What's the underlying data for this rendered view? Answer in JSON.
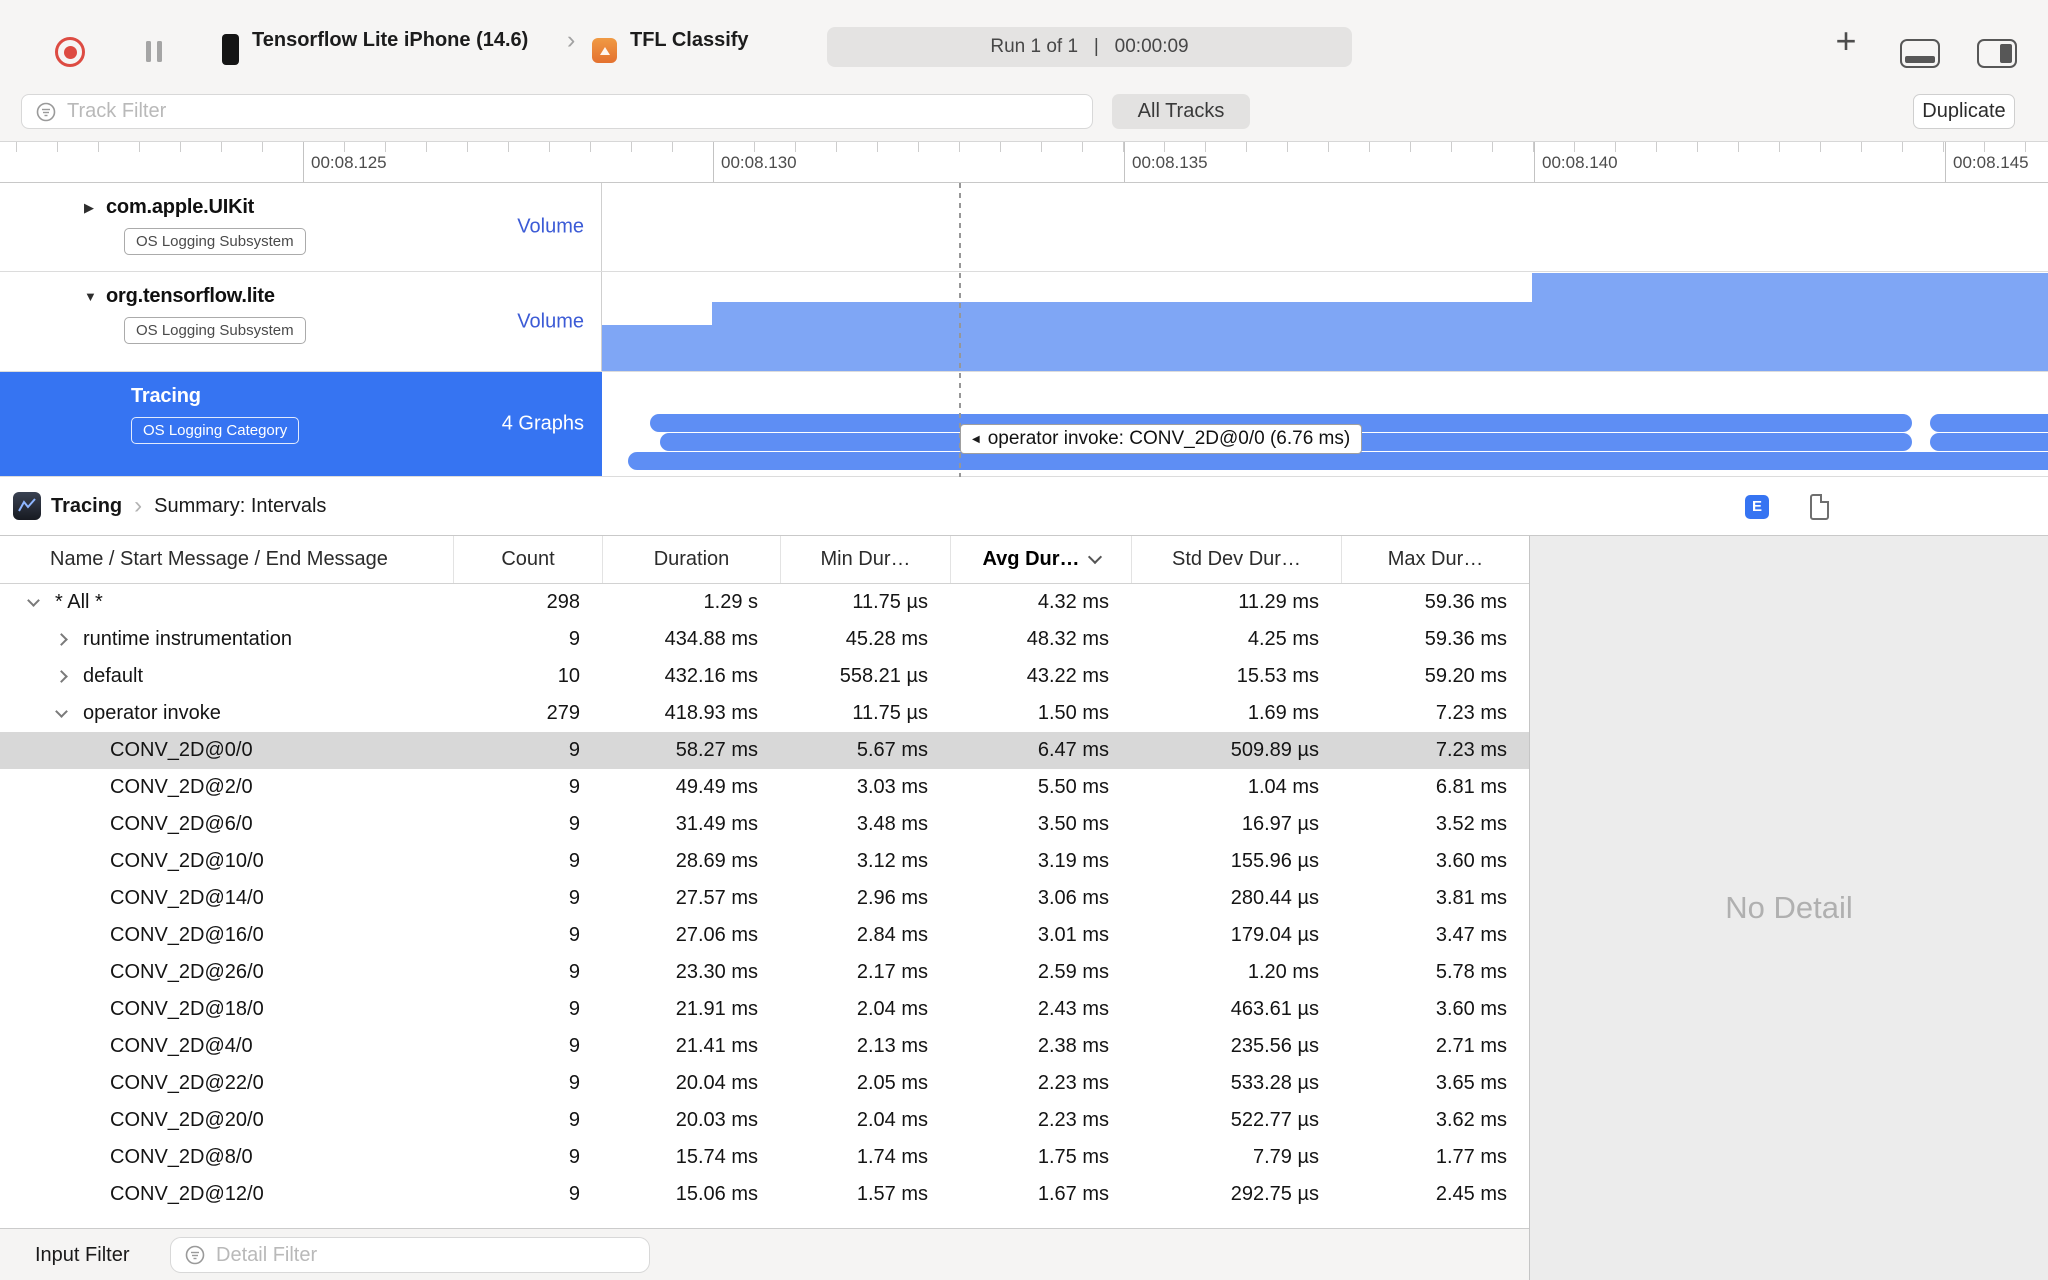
{
  "toolbar": {
    "device": "Tensorflow Lite iPhone (14.6)",
    "target": "TFL Classify",
    "status": "Run 1 of 1   |   00:00:09"
  },
  "filter_bar": {
    "track_filter_placeholder": "Track Filter",
    "all_tracks_label": "All Tracks",
    "duplicate_label": "Duplicate"
  },
  "ruler": {
    "labels": [
      "00:08.125",
      "00:08.130",
      "00:08.135",
      "00:08.140",
      "00:08.145"
    ]
  },
  "tracks": [
    {
      "name": "com.apple.UIKit",
      "badge": "OS Logging Subsystem",
      "meta": "Volume",
      "disclosure": "collapsed",
      "selected": false
    },
    {
      "name": "org.tensorflow.lite",
      "badge": "OS Logging Subsystem",
      "meta": "Volume",
      "disclosure": "expanded",
      "selected": false
    },
    {
      "name": "Tracing",
      "badge": "OS Logging Category",
      "meta": "4 Graphs",
      "disclosure": "none",
      "selected": true
    }
  ],
  "tooltip": "operator invoke: CONV_2D@0/0 (6.76 ms)",
  "breadcrumb": {
    "instrument": "Tracing",
    "summary": "Summary: Intervals",
    "e_badge": "E"
  },
  "table": {
    "columns": [
      "Name / Start Message / End Message",
      "Count",
      "Duration",
      "Min Dur…",
      "Avg Dur…",
      "Std Dev Dur…",
      "Max Dur…"
    ],
    "sorted_column": "Avg Dur…",
    "rows": [
      {
        "name": "* All *",
        "count": "298",
        "duration": "1.29 s",
        "min": "11.75 µs",
        "avg": "4.32 ms",
        "std": "11.29 ms",
        "max": "59.36 ms",
        "level": 0,
        "disclosure": "expanded",
        "selected": false
      },
      {
        "name": "runtime instrumentation",
        "count": "9",
        "duration": "434.88 ms",
        "min": "45.28 ms",
        "avg": "48.32 ms",
        "std": "4.25 ms",
        "max": "59.36 ms",
        "level": 1,
        "disclosure": "collapsed",
        "selected": false
      },
      {
        "name": "default",
        "count": "10",
        "duration": "432.16 ms",
        "min": "558.21 µs",
        "avg": "43.22 ms",
        "std": "15.53 ms",
        "max": "59.20 ms",
        "level": 1,
        "disclosure": "collapsed",
        "selected": false
      },
      {
        "name": "operator invoke",
        "count": "279",
        "duration": "418.93 ms",
        "min": "11.75 µs",
        "avg": "1.50 ms",
        "std": "1.69 ms",
        "max": "7.23 ms",
        "level": 1,
        "disclosure": "expanded",
        "selected": false
      },
      {
        "name": "CONV_2D@0/0",
        "count": "9",
        "duration": "58.27 ms",
        "min": "5.67 ms",
        "avg": "6.47 ms",
        "std": "509.89 µs",
        "max": "7.23 ms",
        "level": 2,
        "disclosure": "",
        "selected": true
      },
      {
        "name": "CONV_2D@2/0",
        "count": "9",
        "duration": "49.49 ms",
        "min": "3.03 ms",
        "avg": "5.50 ms",
        "std": "1.04 ms",
        "max": "6.81 ms",
        "level": 2,
        "disclosure": "",
        "selected": false
      },
      {
        "name": "CONV_2D@6/0",
        "count": "9",
        "duration": "31.49 ms",
        "min": "3.48 ms",
        "avg": "3.50 ms",
        "std": "16.97 µs",
        "max": "3.52 ms",
        "level": 2,
        "disclosure": "",
        "selected": false
      },
      {
        "name": "CONV_2D@10/0",
        "count": "9",
        "duration": "28.69 ms",
        "min": "3.12 ms",
        "avg": "3.19 ms",
        "std": "155.96 µs",
        "max": "3.60 ms",
        "level": 2,
        "disclosure": "",
        "selected": false
      },
      {
        "name": "CONV_2D@14/0",
        "count": "9",
        "duration": "27.57 ms",
        "min": "2.96 ms",
        "avg": "3.06 ms",
        "std": "280.44 µs",
        "max": "3.81 ms",
        "level": 2,
        "disclosure": "",
        "selected": false
      },
      {
        "name": "CONV_2D@16/0",
        "count": "9",
        "duration": "27.06 ms",
        "min": "2.84 ms",
        "avg": "3.01 ms",
        "std": "179.04 µs",
        "max": "3.47 ms",
        "level": 2,
        "disclosure": "",
        "selected": false
      },
      {
        "name": "CONV_2D@26/0",
        "count": "9",
        "duration": "23.30 ms",
        "min": "2.17 ms",
        "avg": "2.59 ms",
        "std": "1.20 ms",
        "max": "5.78 ms",
        "level": 2,
        "disclosure": "",
        "selected": false
      },
      {
        "name": "CONV_2D@18/0",
        "count": "9",
        "duration": "21.91 ms",
        "min": "2.04 ms",
        "avg": "2.43 ms",
        "std": "463.61 µs",
        "max": "3.60 ms",
        "level": 2,
        "disclosure": "",
        "selected": false
      },
      {
        "name": "CONV_2D@4/0",
        "count": "9",
        "duration": "21.41 ms",
        "min": "2.13 ms",
        "avg": "2.38 ms",
        "std": "235.56 µs",
        "max": "2.71 ms",
        "level": 2,
        "disclosure": "",
        "selected": false
      },
      {
        "name": "CONV_2D@22/0",
        "count": "9",
        "duration": "20.04 ms",
        "min": "2.05 ms",
        "avg": "2.23 ms",
        "std": "533.28 µs",
        "max": "3.65 ms",
        "level": 2,
        "disclosure": "",
        "selected": false
      },
      {
        "name": "CONV_2D@20/0",
        "count": "9",
        "duration": "20.03 ms",
        "min": "2.04 ms",
        "avg": "2.23 ms",
        "std": "522.77 µs",
        "max": "3.62 ms",
        "level": 2,
        "disclosure": "",
        "selected": false
      },
      {
        "name": "CONV_2D@8/0",
        "count": "9",
        "duration": "15.74 ms",
        "min": "1.74 ms",
        "avg": "1.75 ms",
        "std": "7.79 µs",
        "max": "1.77 ms",
        "level": 2,
        "disclosure": "",
        "selected": false
      },
      {
        "name": "CONV_2D@12/0",
        "count": "9",
        "duration": "15.06 ms",
        "min": "1.57 ms",
        "avg": "1.67 ms",
        "std": "292.75 µs",
        "max": "2.45 ms",
        "level": 2,
        "disclosure": "",
        "selected": false
      }
    ]
  },
  "detail_panel": {
    "empty_text": "No Detail"
  },
  "bottom_bar": {
    "label": "Input Filter",
    "placeholder": "Detail Filter"
  },
  "colors": {
    "accent": "#3674f2",
    "interval_bar": "#5e8ef4",
    "area_chart": "#7fa6f5",
    "volume_label": "#3c5bd6",
    "selected_row": "#d8d8d8"
  }
}
